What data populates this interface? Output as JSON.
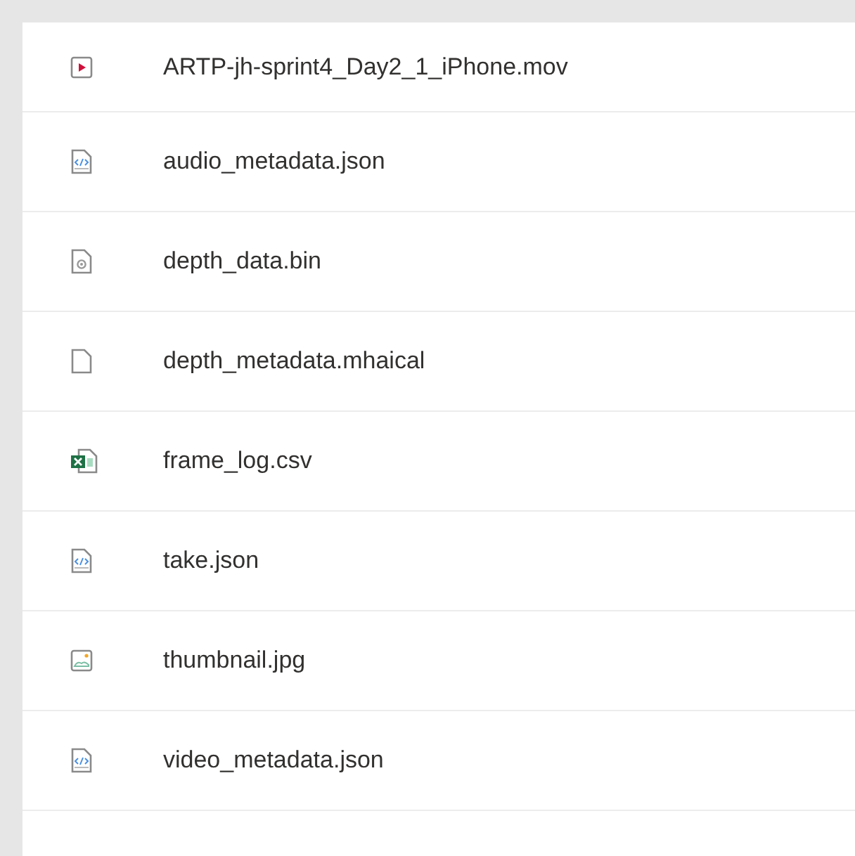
{
  "files": [
    {
      "name": "ARTP-jh-sprint4_Day2_1_iPhone.mov",
      "kind": "video"
    },
    {
      "name": "audio_metadata.json",
      "kind": "code"
    },
    {
      "name": "depth_data.bin",
      "kind": "binary"
    },
    {
      "name": "depth_metadata.mhaical",
      "kind": "generic"
    },
    {
      "name": "frame_log.csv",
      "kind": "spreadsheet"
    },
    {
      "name": "take.json",
      "kind": "code"
    },
    {
      "name": "thumbnail.jpg",
      "kind": "image"
    },
    {
      "name": "video_metadata.json",
      "kind": "code"
    }
  ]
}
